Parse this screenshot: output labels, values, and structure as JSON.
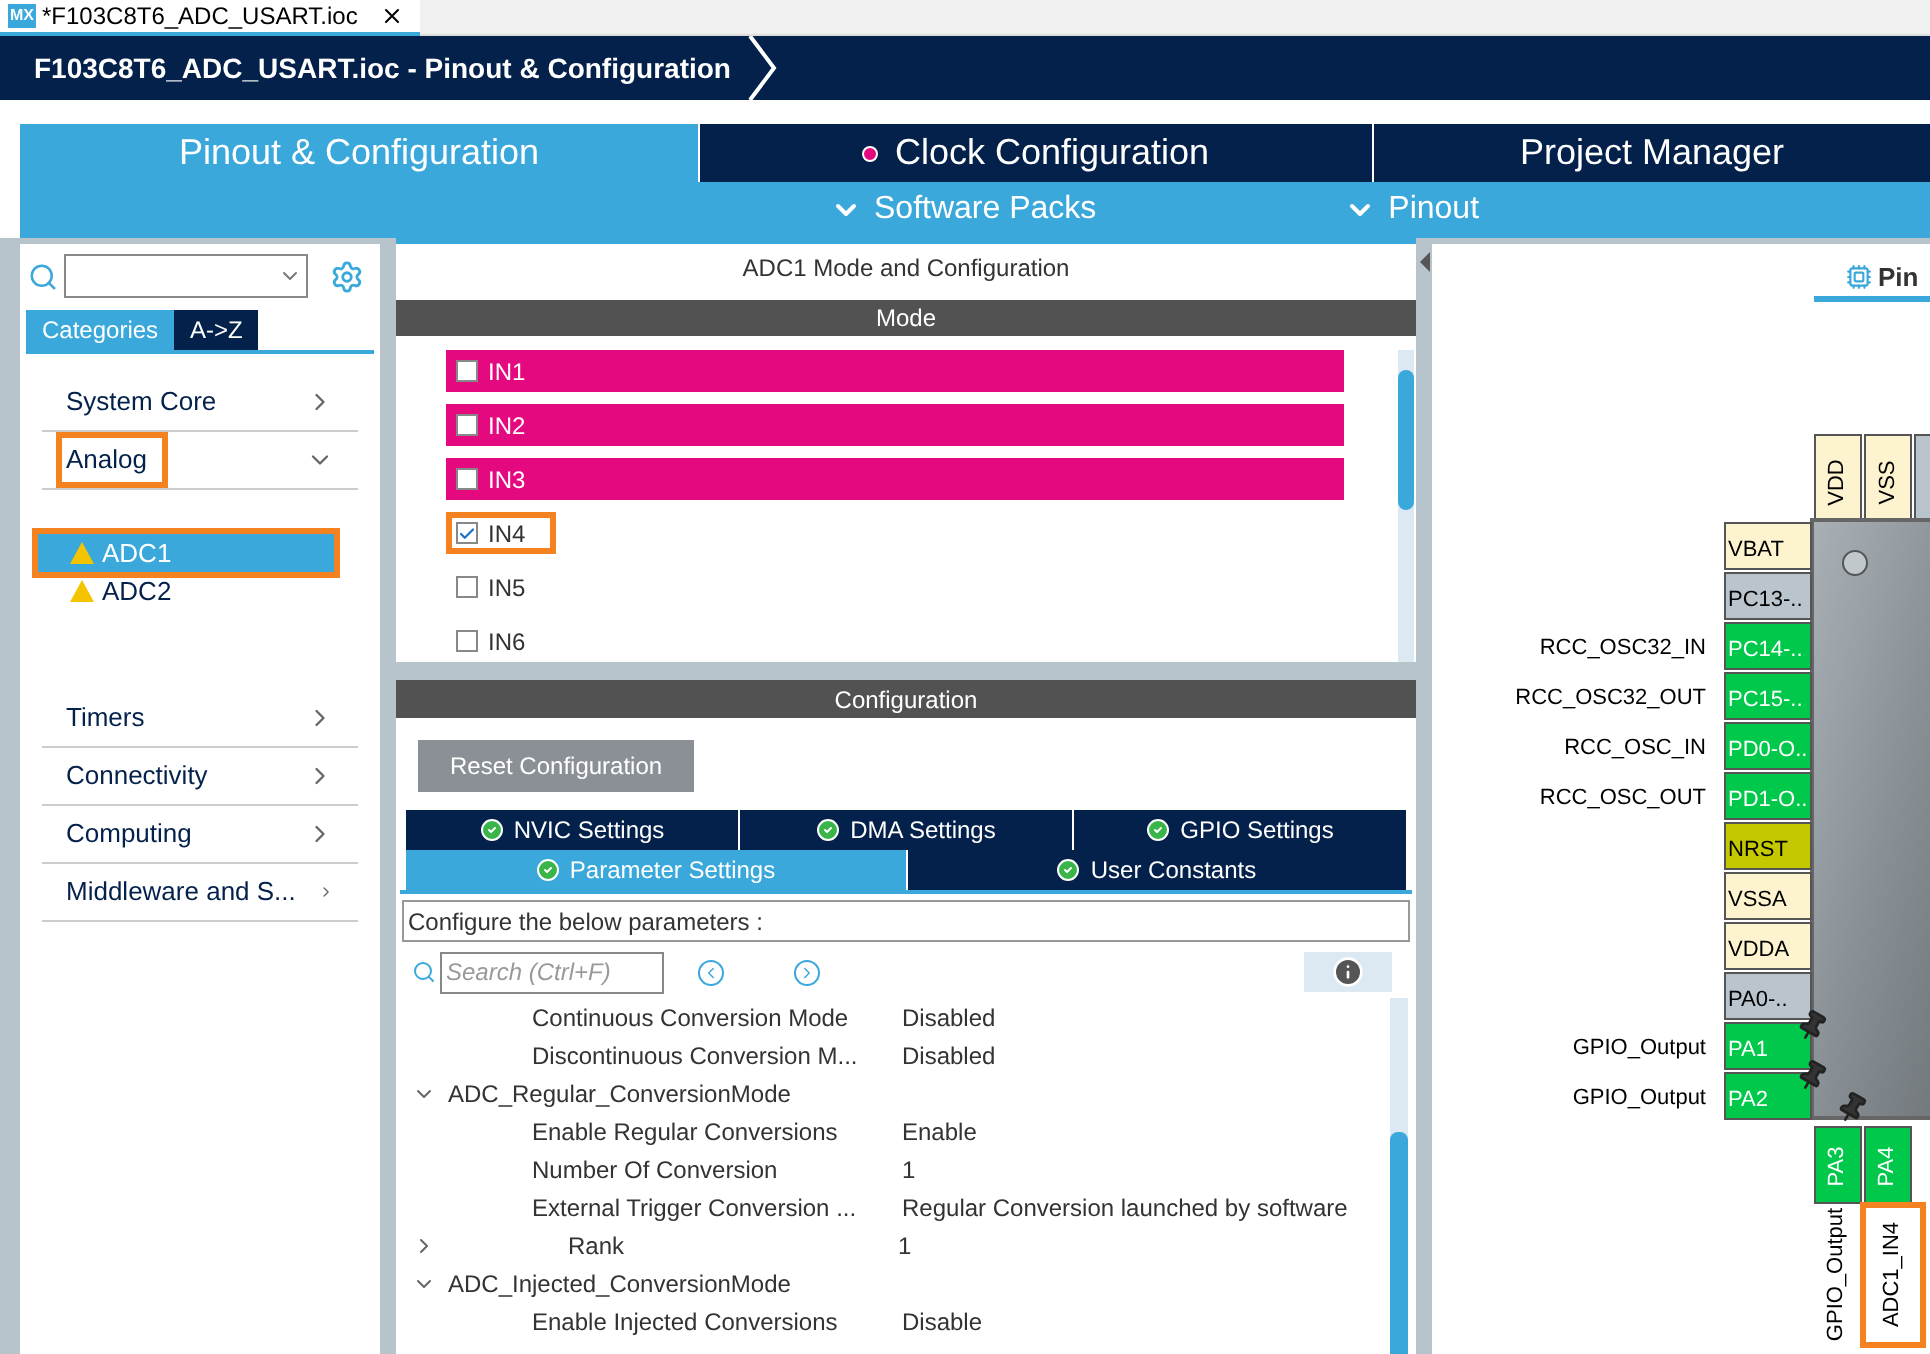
{
  "file_tab": {
    "title": "*F103C8T6_ADC_USART.ioc",
    "logo": "MX"
  },
  "breadcrumb": "F103C8T6_ADC_USART.ioc - Pinout & Configuration",
  "main_tabs": [
    {
      "label": "Pinout & Configuration",
      "selected": true,
      "dot": false
    },
    {
      "label": "Clock Configuration",
      "selected": false,
      "dot": true
    },
    {
      "label": "Project Manager",
      "selected": false,
      "dot": false
    }
  ],
  "sub_menus": [
    {
      "label": "Software Packs"
    },
    {
      "label": "Pinout"
    }
  ],
  "sidebar": {
    "view_tabs": [
      {
        "label": "Categories",
        "selected": true
      },
      {
        "label": "A->Z",
        "selected": false
      }
    ],
    "categories": [
      {
        "label": "System Core",
        "expanded": false,
        "highlighted": false
      },
      {
        "label": "Analog",
        "expanded": true,
        "highlighted": true,
        "children": [
          {
            "label": "ADC1",
            "selected": true,
            "warning": true,
            "highlighted": true
          },
          {
            "label": "ADC2",
            "selected": false,
            "warning": true,
            "highlighted": false
          }
        ]
      },
      {
        "label": "Timers",
        "expanded": false,
        "highlighted": false
      },
      {
        "label": "Connectivity",
        "expanded": false,
        "highlighted": false
      },
      {
        "label": "Computing",
        "expanded": false,
        "highlighted": false
      },
      {
        "label": "Middleware and S...",
        "expanded": false,
        "highlighted": false
      }
    ]
  },
  "mode_panel": {
    "title": "ADC1 Mode and Configuration",
    "section": "Mode",
    "channels": [
      {
        "label": "IN1",
        "checked": false,
        "conflict": true,
        "highlighted": false
      },
      {
        "label": "IN2",
        "checked": false,
        "conflict": true,
        "highlighted": false
      },
      {
        "label": "IN3",
        "checked": false,
        "conflict": true,
        "highlighted": false
      },
      {
        "label": "IN4",
        "checked": true,
        "conflict": false,
        "highlighted": true
      },
      {
        "label": "IN5",
        "checked": false,
        "conflict": false,
        "highlighted": false
      },
      {
        "label": "IN6",
        "checked": false,
        "conflict": false,
        "highlighted": false
      }
    ]
  },
  "config_panel": {
    "section": "Configuration",
    "reset_button": "Reset Configuration",
    "tab_rows": [
      [
        {
          "label": "NVIC Settings",
          "selected": false
        },
        {
          "label": "DMA Settings",
          "selected": false
        },
        {
          "label": "GPIO Settings",
          "selected": false
        }
      ],
      [
        {
          "label": "Parameter Settings",
          "selected": true
        },
        {
          "label": "User Constants",
          "selected": false
        }
      ]
    ],
    "hint": "Configure the below parameters :",
    "search_placeholder": "Search (Ctrl+F)",
    "params": [
      {
        "kind": "item",
        "label": "Continuous Conversion Mode",
        "value": "Disabled"
      },
      {
        "kind": "item",
        "label": "Discontinuous Conversion M...",
        "value": "Disabled"
      },
      {
        "kind": "group",
        "label": "ADC_Regular_ConversionMode",
        "expanded": true
      },
      {
        "kind": "item",
        "label": "Enable Regular Conversions",
        "value": "Enable"
      },
      {
        "kind": "item",
        "label": "Number Of Conversion",
        "value": "1"
      },
      {
        "kind": "item",
        "label": "External Trigger Conversion ...",
        "value": "Regular Conversion launched by software"
      },
      {
        "kind": "subgroup",
        "label": "Rank",
        "value": "1",
        "expanded": false
      },
      {
        "kind": "group",
        "label": "ADC_Injected_ConversionMode",
        "expanded": true
      },
      {
        "kind": "item",
        "label": "Enable Injected Conversions",
        "value": "Disable"
      }
    ]
  },
  "pinout_view": {
    "tab": "Pin",
    "top_pins": [
      {
        "label": "VDD",
        "kind": "power"
      },
      {
        "label": "VSS",
        "kind": "power"
      },
      {
        "kind": "unused"
      }
    ],
    "left_pins": [
      {
        "label": "VBAT",
        "kind": "power"
      },
      {
        "label": "PC13-..",
        "kind": "unused"
      },
      {
        "label": "PC14-..",
        "kind": "assigned",
        "signal": "RCC_OSC32_IN"
      },
      {
        "label": "PC15-..",
        "kind": "assigned",
        "signal": "RCC_OSC32_OUT"
      },
      {
        "label": "PD0-O..",
        "kind": "assigned",
        "signal": "RCC_OSC_IN"
      },
      {
        "label": "PD1-O..",
        "kind": "assigned",
        "signal": "RCC_OSC_OUT"
      },
      {
        "label": "NRST",
        "kind": "reset"
      },
      {
        "label": "VSSA",
        "kind": "power"
      },
      {
        "label": "VDDA",
        "kind": "power"
      },
      {
        "label": "PA0-..",
        "kind": "unused"
      },
      {
        "label": "PA1",
        "kind": "assigned",
        "signal": "GPIO_Output",
        "pinned": true
      },
      {
        "label": "PA2",
        "kind": "assigned",
        "signal": "GPIO_Output",
        "pinned": true
      }
    ],
    "bottom_pins": [
      {
        "label": "PA3",
        "kind": "assigned",
        "signal": "GPIO_Output",
        "pinned": true,
        "highlighted": false
      },
      {
        "label": "PA4",
        "kind": "assigned",
        "signal": "ADC1_IN4",
        "pinned": false,
        "highlighted": true
      }
    ]
  }
}
